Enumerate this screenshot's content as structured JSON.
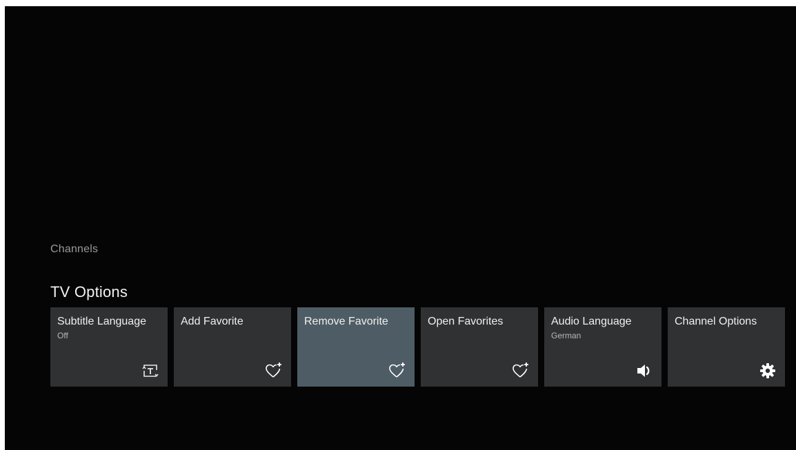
{
  "header": {
    "breadcrumb": "Channels",
    "title": "TV Options"
  },
  "options": [
    {
      "label": "Subtitle Language",
      "value": "Off",
      "icon": "subtitle-icon"
    },
    {
      "label": "Add Favorite",
      "value": "",
      "icon": "heart-plus-icon"
    },
    {
      "label": "Remove Favorite",
      "value": "",
      "icon": "heart-plus-icon",
      "focused": true
    },
    {
      "label": "Open Favorites",
      "value": "",
      "icon": "heart-plus-icon"
    },
    {
      "label": "Audio Language",
      "value": "German",
      "icon": "speaker-icon"
    },
    {
      "label": "Channel Options",
      "value": "",
      "icon": "gear-icon"
    }
  ],
  "colors": {
    "background": "#050505",
    "card": "#2f3133",
    "card_focused": "#4e5c65",
    "text": "#f0f0f0",
    "muted_text": "#9a9a9a"
  }
}
